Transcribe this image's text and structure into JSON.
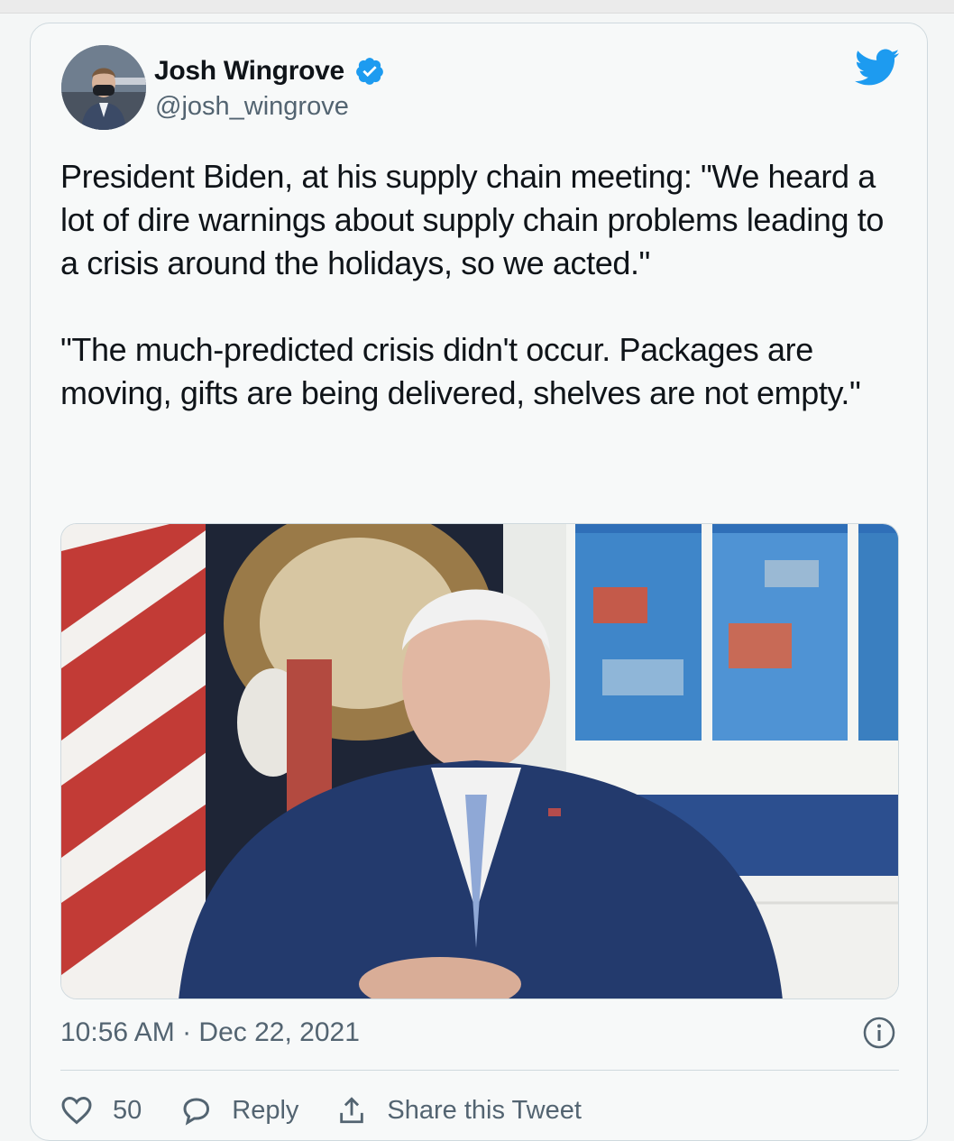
{
  "tweet": {
    "author_name": "Josh Wingrove",
    "author_handle": "@josh_wingrove",
    "verified": true,
    "paragraphs": [
      "President Biden, at his supply chain meeting: \"We heard a lot of dire warnings about supply chain problems leading to a crisis around the holidays, so we acted.\"",
      "\"The much-predicted crisis didn't occur. Packages are moving, gifts are being delivered, shelves are not empty.\""
    ],
    "timestamp": "10:56 AM · Dec 22, 2021"
  },
  "actions": {
    "like_count": "50",
    "reply_label": "Reply",
    "share_label": "Share this Tweet"
  },
  "colors": {
    "brand_blue": "#1d9bf0",
    "secondary_text": "#536471",
    "primary_text": "#0f1419"
  },
  "icons": [
    "verified-badge-icon",
    "twitter-bird-icon",
    "info-icon",
    "heart-icon",
    "reply-bubble-icon",
    "share-icon"
  ]
}
